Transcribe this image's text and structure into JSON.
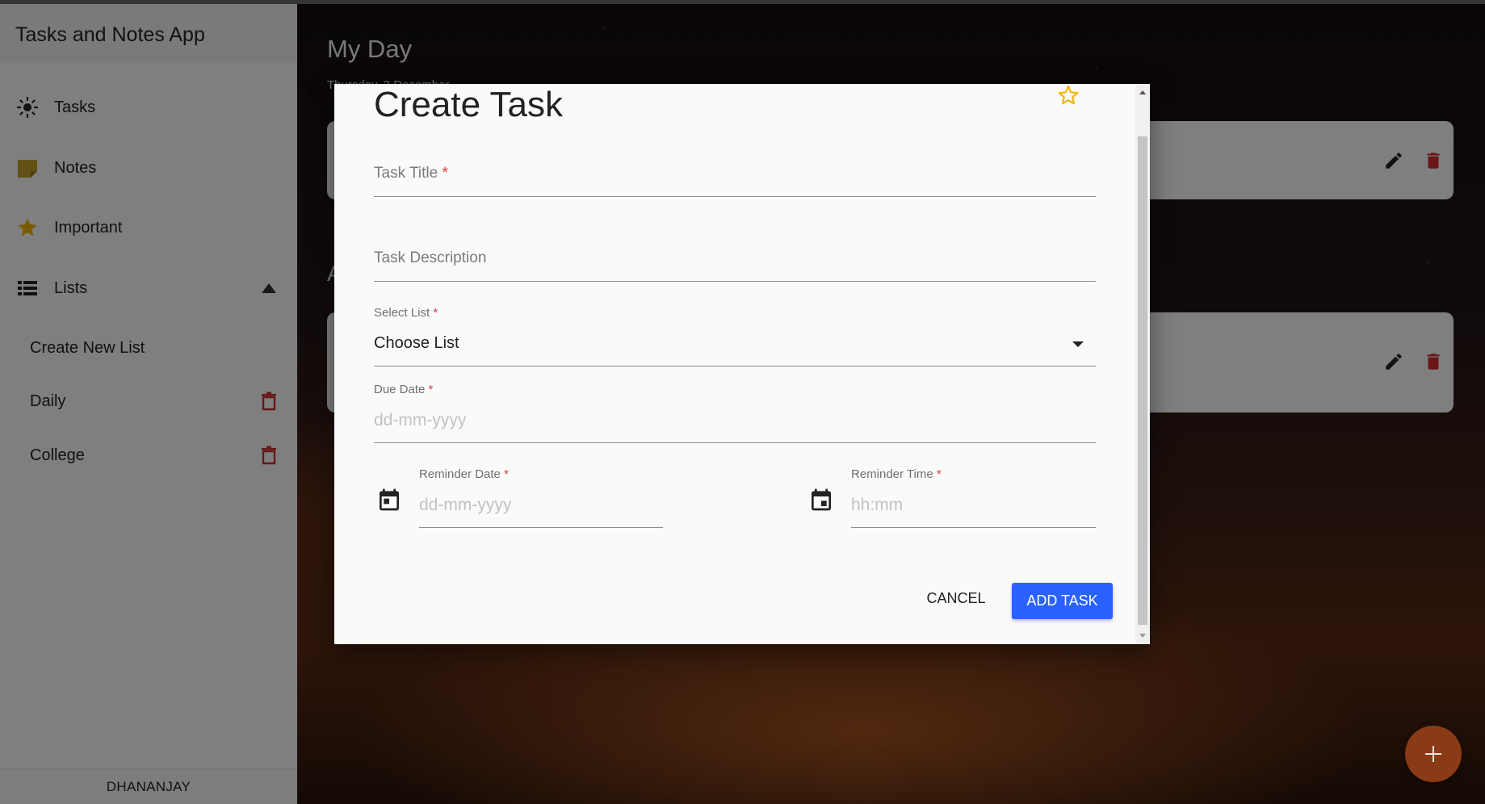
{
  "app": {
    "title": "Tasks and Notes App",
    "user": "DHANANJAY"
  },
  "sidebar": {
    "items": [
      {
        "label": "Tasks",
        "icon": "sun-icon"
      },
      {
        "label": "Notes",
        "icon": "note-icon"
      },
      {
        "label": "Important",
        "icon": "star-icon"
      },
      {
        "label": "Lists",
        "icon": "list-icon"
      }
    ],
    "lists": [
      {
        "label": "Create New List"
      },
      {
        "label": "Daily"
      },
      {
        "label": "College"
      }
    ]
  },
  "main": {
    "title": "My Day",
    "date": "Thursday, 3 December",
    "section_letter": "A"
  },
  "dialog": {
    "title": "Create Task",
    "task_title_label": "Task Title",
    "task_description_label": "Task Description",
    "select_list_label": "Select List",
    "select_list_value": "Choose List",
    "due_date_label": "Due Date",
    "due_date_placeholder": "dd-mm-yyyy",
    "reminder_date_label": "Reminder Date",
    "reminder_date_placeholder": "dd-mm-yyyy",
    "reminder_time_label": "Reminder Time",
    "reminder_time_placeholder": "hh:mm",
    "required_mark": "*",
    "cancel_label": "CANCEL",
    "add_label": "ADD TASK"
  },
  "colors": {
    "accent": "#2962ff",
    "delete": "#d32f2f",
    "star": "#f4b400",
    "notes_icon": "#c6a22a"
  }
}
